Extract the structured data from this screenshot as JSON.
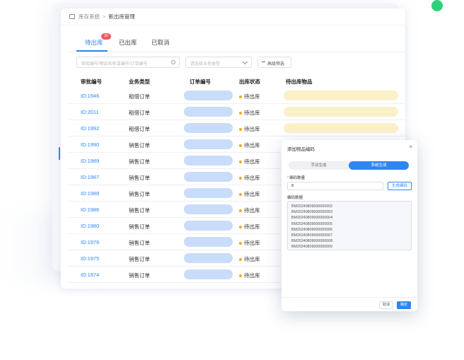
{
  "breadcrumb": {
    "root": "库存系统",
    "separator": ">",
    "current": "新出库管理"
  },
  "tabs": [
    {
      "label": "待出库",
      "badge": "20"
    },
    {
      "label": "已出库"
    },
    {
      "label": "已取消"
    }
  ],
  "filters": {
    "search_placeholder": "审批编号/物品名称或编号/订单编号",
    "type_placeholder": "请选择业务类型",
    "advanced_label": "高级筛选"
  },
  "table": {
    "headers": [
      "审批编号",
      "业务类型",
      "订单编号",
      "出库状态",
      "待出库物品"
    ],
    "rows": [
      {
        "id": "ID:1946",
        "type": "租借订单",
        "status": "待出库"
      },
      {
        "id": "ID:2011",
        "type": "租借订单",
        "status": "待出库"
      },
      {
        "id": "ID:1992",
        "type": "租借订单",
        "status": "待出库"
      },
      {
        "id": "ID:1990",
        "type": "销售订单",
        "status": "待出库"
      },
      {
        "id": "ID:1989",
        "type": "销售订单",
        "status": "待出库"
      },
      {
        "id": "ID:1987",
        "type": "销售订单",
        "status": "待出库"
      },
      {
        "id": "ID:1988",
        "type": "销售订单",
        "status": "待出库"
      },
      {
        "id": "ID:1986",
        "type": "销售订单",
        "status": "待出库"
      },
      {
        "id": "ID:1980",
        "type": "销售订单",
        "status": "待出库"
      },
      {
        "id": "ID:1976",
        "type": "销售订单",
        "status": "待出库"
      },
      {
        "id": "ID:1975",
        "type": "销售订单",
        "status": "待出库"
      },
      {
        "id": "ID:1974",
        "type": "销售订单",
        "status": "待出库"
      }
    ]
  },
  "modal": {
    "title": "添加物品编码",
    "close": "×",
    "seg_manual": "手动生成",
    "seg_system": "系统生成",
    "qty_label": "编码数量",
    "qty_value": "8",
    "generate_label": "生成编码",
    "codes_label": "编码数据",
    "codes": [
      "BM20240809000000002",
      "BM20240809000000003",
      "BM20240809000000004",
      "BM20240809000000005",
      "BM20240809000000006",
      "BM20240809000000007",
      "BM20240809000000008",
      "BM20240809000000009"
    ],
    "cancel_label": "取消",
    "ok_label": "确定"
  },
  "colors": {
    "accent": "#2e86f5",
    "status_dot": "#f5a623",
    "badge": "#f2565d",
    "order_placeholder": "#c9dcf9",
    "goods_placeholder": "#fbf1c9",
    "green_dot": "#2fd07a"
  }
}
